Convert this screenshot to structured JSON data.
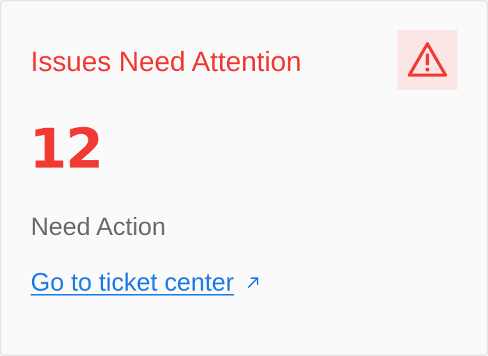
{
  "card": {
    "title": "Issues Need Attention",
    "alert_icon": "warning-triangle-icon",
    "count": "12",
    "subtitle": "Need Action",
    "link_label": "Go to ticket center",
    "link_icon": "external-arrow-icon"
  },
  "colors": {
    "accent_red": "#f23a34",
    "badge_background": "#fbe5e5",
    "link_blue": "#1e7ae6",
    "muted_text": "#6b6b6b",
    "card_background": "#fafafa",
    "card_border": "#e3e3e3"
  }
}
